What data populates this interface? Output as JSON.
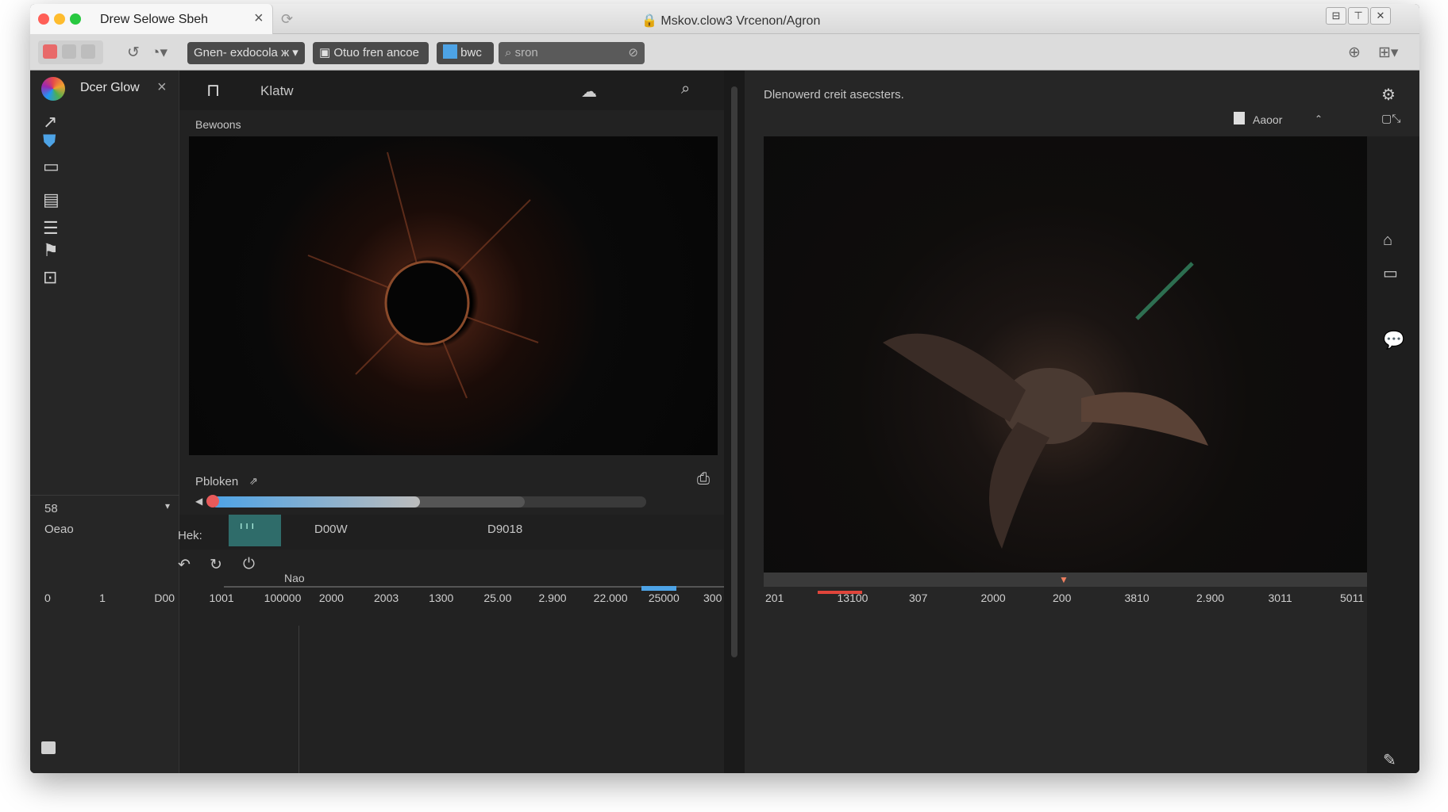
{
  "window": {
    "tab_title": "Drew Selowe Sbeh",
    "title": "Mskov.clow3 Vrcenon/Agron",
    "controls": [
      "⊟",
      "⊤",
      "✕"
    ]
  },
  "toolbar": {
    "dropdown_label": "Gnen- exdocola ж",
    "save_label": "Otuo fren ancoe",
    "toggle_label": "bwc",
    "search_placeholder": "sron"
  },
  "sidebar": {
    "app_name": "Dcer Glow",
    "field_value": "58",
    "field_label": "Oeao"
  },
  "left_panel": {
    "header_label": "Klatw",
    "section_label": "Bewoons",
    "player_label": "Pbloken",
    "track_label": "Hek:",
    "col1": "D00W",
    "col2": "D9018",
    "marker_label": "Nao"
  },
  "right_panel": {
    "header_label": "Dlenowerd creit asecsters.",
    "dropdown_label": "Aaoor"
  },
  "timeline_left": [
    "0",
    "1",
    "D00",
    "1001",
    "100000",
    "2000",
    "2003",
    "1300",
    "25.00",
    "2.900",
    "22.000",
    "25000",
    "300"
  ],
  "timeline_right": [
    "201",
    "13100",
    "307",
    "2000",
    "200",
    "3810",
    "2.900",
    "3011",
    "5011"
  ],
  "progress": {
    "scrub_fill_fraction": 0.48,
    "buffered_fraction": 0.72
  },
  "colors": {
    "accent_blue": "#4da3e6",
    "record_red": "#e0453b",
    "teal": "#2f6c6a"
  }
}
